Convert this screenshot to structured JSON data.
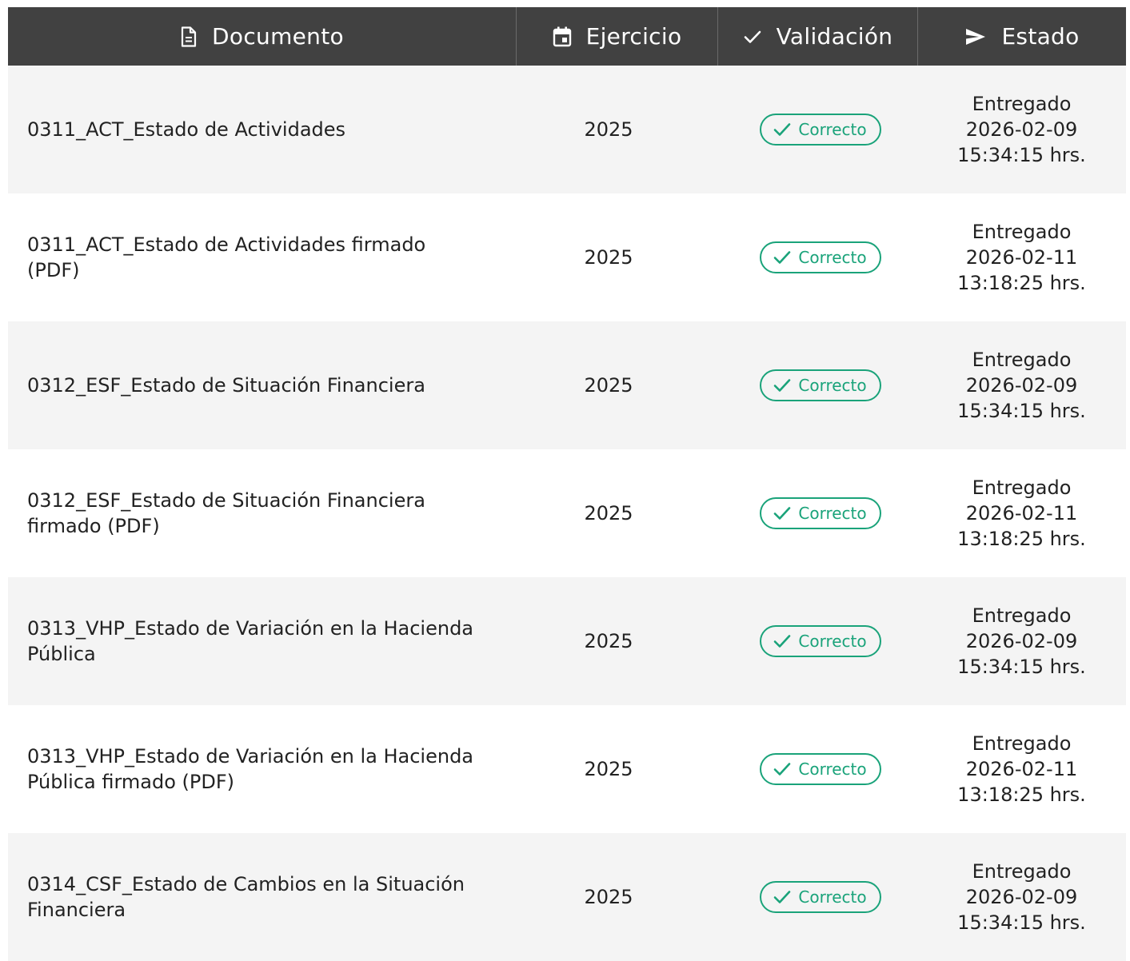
{
  "header": {
    "documento": "Documento",
    "ejercicio": "Ejercicio",
    "validacion": "Validación",
    "estado": "Estado"
  },
  "colors": {
    "header_bg": "#414141",
    "badge_green": "#1aa37a",
    "row_shaded": "#f4f4f4"
  },
  "icons": {
    "documento": "document-icon",
    "ejercicio": "calendar-icon",
    "validacion": "check-icon",
    "estado": "send-icon",
    "badge": "check-icon"
  },
  "rows": [
    {
      "documento": "0311_ACT_Estado de Actividades",
      "ejercicio": "2025",
      "validacion": "Correcto",
      "estado": "Entregado 2026-02-09 15:34:15 hrs."
    },
    {
      "documento": "0311_ACT_Estado de Actividades firmado (PDF)",
      "ejercicio": "2025",
      "validacion": "Correcto",
      "estado": "Entregado 2026-02-11 13:18:25 hrs."
    },
    {
      "documento": "0312_ESF_Estado de Situación Financiera",
      "ejercicio": "2025",
      "validacion": "Correcto",
      "estado": "Entregado 2026-02-09 15:34:15 hrs."
    },
    {
      "documento": "0312_ESF_Estado de Situación Financiera firmado (PDF)",
      "ejercicio": "2025",
      "validacion": "Correcto",
      "estado": "Entregado 2026-02-11 13:18:25 hrs."
    },
    {
      "documento": "0313_VHP_Estado de Variación en la Hacienda Pública",
      "ejercicio": "2025",
      "validacion": "Correcto",
      "estado": "Entregado 2026-02-09 15:34:15 hrs."
    },
    {
      "documento": "0313_VHP_Estado de Variación en la Hacienda Pública firmado (PDF)",
      "ejercicio": "2025",
      "validacion": "Correcto",
      "estado": "Entregado 2026-02-11 13:18:25 hrs."
    },
    {
      "documento": "0314_CSF_Estado de Cambios en la Situación Financiera",
      "ejercicio": "2025",
      "validacion": "Correcto",
      "estado": "Entregado 2026-02-09 15:34:15 hrs."
    }
  ]
}
